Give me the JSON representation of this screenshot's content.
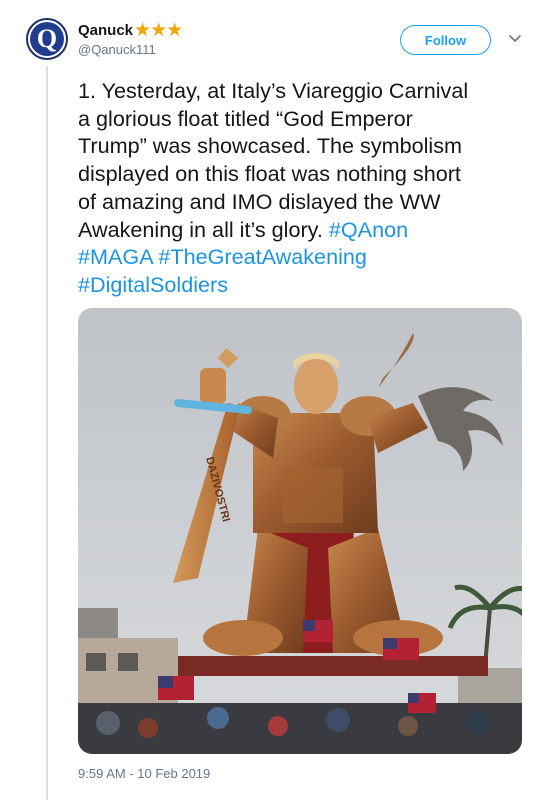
{
  "tweet": {
    "display_name": "Qanuck",
    "name_emoji": "★★★",
    "handle": "@Qanuck111",
    "avatar_letter": "Q",
    "follow_label": "Follow",
    "text_lines": [
      [
        {
          "t": "1. Yesterday, at Italy’s Viareggio Carnival",
          "tag": false
        }
      ],
      [
        {
          "t": "a glorious float titled “God Emperor",
          "tag": false
        }
      ],
      [
        {
          "t": "Trump” was showcased. The symbolism",
          "tag": false
        }
      ],
      [
        {
          "t": "displayed on this float was nothing short",
          "tag": false
        }
      ],
      [
        {
          "t": "of amazing and IMO dislayed the WW",
          "tag": false
        }
      ],
      [
        {
          "t": "Awakening in all it’s glory. ",
          "tag": false
        },
        {
          "t": "#QAnon",
          "tag": true
        }
      ],
      [
        {
          "t": "#MAGA",
          "tag": true
        },
        {
          "t": " ",
          "tag": false
        },
        {
          "t": "#TheGreatAwakening",
          "tag": true
        }
      ],
      [
        {
          "t": "#DigitalSoldiers",
          "tag": true
        }
      ]
    ],
    "timestamp": "9:59 AM - 10 Feb 2019"
  },
  "media": {
    "sword_inscription": "DAZIVOSTRI"
  },
  "colors": {
    "link": "#1b95e0",
    "follow_border": "#1da1f2",
    "thread_line": "#cfe3f3",
    "meta_gray": "#657786",
    "star": "#f2a600"
  },
  "icons": [
    "q-avatar-icon",
    "chevron-down-icon",
    "star-emoji-icon"
  ]
}
